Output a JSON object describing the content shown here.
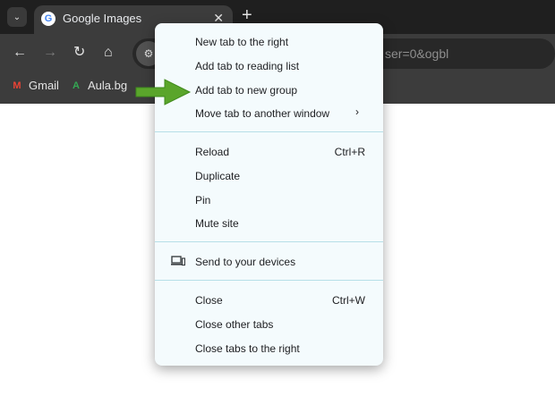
{
  "tab": {
    "title": "Google Images",
    "favicon_letter": "G",
    "close_glyph": "✕"
  },
  "tabstrip": {
    "new_tab_glyph": "+",
    "search_glyph": "⌄"
  },
  "toolbar": {
    "back_glyph": "←",
    "forward_glyph": "→",
    "reload_glyph": "↻",
    "home_glyph": "⌂",
    "address_text": "ser=0&ogbl"
  },
  "bookmarks": [
    {
      "label": "Gmail",
      "icon": "gmail-icon",
      "glyph": "M"
    },
    {
      "label": "Aula.bg",
      "icon": "aula-icon",
      "glyph": "A"
    }
  ],
  "menu": {
    "items": [
      {
        "label": "New tab to the right"
      },
      {
        "label": "Add tab to reading list"
      },
      {
        "label": "Add tab to new group"
      },
      {
        "label": "Move tab to another window",
        "submenu": "›"
      },
      {
        "label": "Reload",
        "shortcut": "Ctrl+R"
      },
      {
        "label": "Duplicate"
      },
      {
        "label": "Pin"
      },
      {
        "label": "Mute site"
      },
      {
        "label": "Send to your devices",
        "icon": "devices-icon"
      },
      {
        "label": "Close",
        "shortcut": "Ctrl+W"
      },
      {
        "label": "Close other tabs"
      },
      {
        "label": "Close tabs to the right"
      }
    ]
  },
  "annotation": {
    "arrow_color": "#5aa52b",
    "points_to": "Add tab to new group"
  },
  "colors": {
    "menu_bg": "#f4fbfd",
    "separator": "#b7dfe8",
    "chrome_dark": "#1f1f1f",
    "toolbar": "#3c3c3c"
  }
}
